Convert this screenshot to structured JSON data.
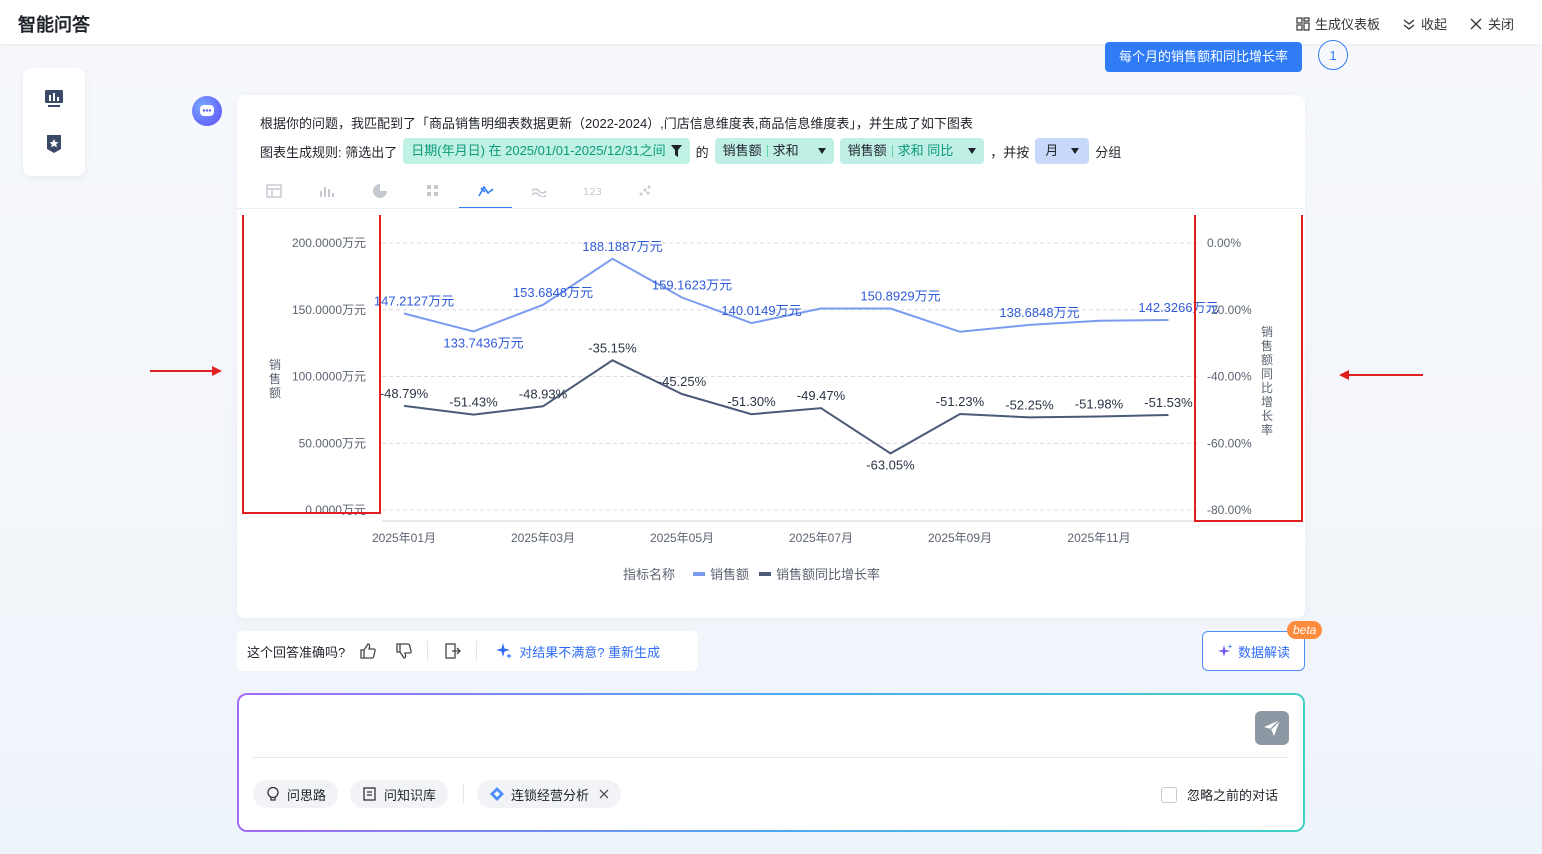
{
  "app": {
    "title": "智能问答"
  },
  "top_actions": [
    {
      "label": "生成仪表板",
      "icon": "dashboard-icon"
    },
    {
      "label": "收起",
      "icon": "collapse-icon"
    },
    {
      "label": "关闭",
      "icon": "close-icon"
    }
  ],
  "sidebar": {
    "icons": [
      "board-icon",
      "favorite-star-icon"
    ]
  },
  "user_query": {
    "text": "每个月的销售额和同比增长率",
    "count": "1"
  },
  "answer": {
    "intro": "根据你的问题，我匹配到了「商品销售明细表数据更新（2022-2024）,门店信息维度表,商品信息维度表」，并生成了如下图表",
    "rule_prefix": "图表生成规则: 筛选出了",
    "filter_chip": "日期(年月日) 在 2025/01/01-2025/12/31之间",
    "of": "的",
    "measure1_name": "销售额",
    "measure1_agg": "求和",
    "measure2_name": "销售额",
    "measure2_agg": "求和 同比",
    "group_prefix": "，并按",
    "group_value": "月",
    "group_suffix": "分组"
  },
  "chart_tabs": [
    "table-icon",
    "bar-chart-icon",
    "pie-chart-icon",
    "dot-grid-icon",
    "line-chart-icon",
    "area-chart-icon",
    "number-card-icon",
    "scatter-icon"
  ],
  "chart_tabs_active": 4,
  "chart_data": {
    "type": "line",
    "x": [
      "2025年01月",
      "2025年02月",
      "2025年03月",
      "2025年04月",
      "2025年05月",
      "2025年06月",
      "2025年07月",
      "2025年08月",
      "2025年09月",
      "2025年10月",
      "2025年11月",
      "2025年12月"
    ],
    "x_tick_labels": [
      "2025年01月",
      "2025年03月",
      "2025年05月",
      "2025年07月",
      "2025年09月",
      "2025年11月"
    ],
    "y_left": {
      "label": "销售额",
      "ticks": [
        "0.0000万元",
        "50.0000万元",
        "100.0000万元",
        "150.0000万元",
        "200.0000万元"
      ],
      "range": [
        0,
        200
      ]
    },
    "y_right": {
      "label": "销售额同比增长率",
      "ticks": [
        "0.00%",
        "-20.00%",
        "-40.00%",
        "-60.00%",
        "-80.00%"
      ],
      "range": [
        -80,
        0
      ]
    },
    "series": [
      {
        "name": "销售额",
        "axis": "left",
        "color": "#7b9bf0",
        "values": [
          147.2127,
          133.7436,
          153.6848,
          188.1887,
          159.1623,
          140.0149,
          150.8929,
          150.8929,
          133.5,
          138.6848,
          141.8,
          142.3266
        ],
        "labels": [
          "147.2127万元",
          "133.7436万元",
          "153.6848万元",
          "188.1887万元",
          "159.1623万元",
          "140.0149万元",
          "",
          "150.8929万元",
          "",
          "138.6848万元",
          "",
          "142.3266万元"
        ]
      },
      {
        "name": "销售额同比增长率",
        "axis": "right",
        "color": "#4a5a78",
        "values": [
          -48.79,
          -51.43,
          -48.93,
          -35.15,
          -45.25,
          -51.3,
          -49.47,
          -63.05,
          -51.23,
          -52.25,
          -51.98,
          -51.53
        ],
        "labels": [
          "-48.79%",
          "-51.43%",
          "-48.93%",
          "-35.15%",
          "-45.25%",
          "-51.30%",
          "-49.47%",
          "-63.05%",
          "-51.23%",
          "-52.25%",
          "-51.98%",
          "-51.53%"
        ]
      }
    ],
    "legend": {
      "title": "指标名称",
      "placement": "bottom"
    },
    "grid": true
  },
  "feedback": {
    "question": "这个回答准确吗?",
    "regenerate": "对结果不满意? 重新生成"
  },
  "interpret": {
    "label": "数据解读",
    "badge": "beta"
  },
  "input": {
    "placeholder": "",
    "pills": [
      {
        "label": "问思路",
        "icon": "bulb-icon"
      },
      {
        "label": "问知识库",
        "icon": "book-icon"
      },
      {
        "label": "连锁经营分析",
        "icon": "diamond-icon"
      }
    ],
    "ignore_label": "忽略之前的对话"
  },
  "colors": {
    "accent": "#2f7cf6",
    "annotation": "#e02020"
  }
}
